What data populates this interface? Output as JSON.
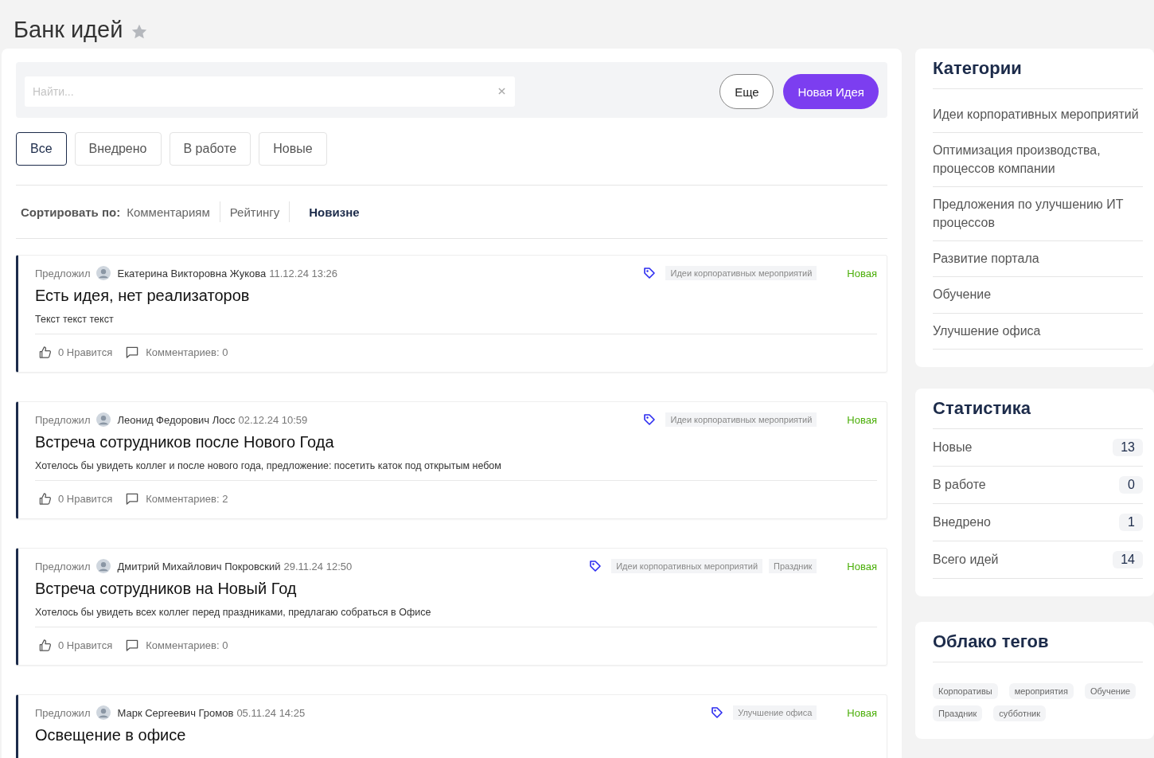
{
  "page": {
    "title": "Банк идей",
    "favorite": false
  },
  "search": {
    "placeholder": "Найти..."
  },
  "buttons": {
    "more": "Еще",
    "new_idea": "Новая Идея"
  },
  "filters": [
    {
      "label": "Все",
      "selected": true
    },
    {
      "label": "Внедрено",
      "selected": false
    },
    {
      "label": "В работе",
      "selected": false
    },
    {
      "label": "Новые",
      "selected": false
    }
  ],
  "sort": {
    "label": "Сортировать по:",
    "options": [
      {
        "label": "Комментариям",
        "selected": false
      },
      {
        "label": "Рейтингу",
        "selected": false
      },
      {
        "label": "Новизне",
        "selected": true
      }
    ]
  },
  "ideas": [
    {
      "prefix": "Предложил",
      "author": "Екатерина Викторовна Жукова",
      "date": "11.12.24 13:26",
      "tags": [
        "Идеи корпоративных мероприятий"
      ],
      "status": "Новая",
      "title": "Есть идея, нет реализаторов",
      "text": "Текст текст текст",
      "likes": "0 Нравится",
      "comments": "Комментариев: 0"
    },
    {
      "prefix": "Предложил",
      "author": "Леонид Федорович Лосс",
      "date": "02.12.24 10:59",
      "tags": [
        "Идеи корпоративных мероприятий"
      ],
      "status": "Новая",
      "title": "Встреча сотрудников после Нового Года",
      "text": "Хотелось бы увидеть коллег и после нового года, предложение: посетить каток под открытым небом",
      "likes": "0 Нравится",
      "comments": "Комментариев: 2"
    },
    {
      "prefix": "Предложил",
      "author": "Дмитрий Михайлович Покровский",
      "date": "29.11.24 12:50",
      "tags": [
        "Идеи корпоративных мероприятий",
        "Праздник"
      ],
      "status": "Новая",
      "title": "Встреча сотрудников на Новый Год",
      "text": "Хотелось бы увидеть всех коллег перед праздниками, предлагаю собраться в Офисе",
      "likes": "0 Нравится",
      "comments": "Комментариев: 0"
    },
    {
      "prefix": "Предложил",
      "author": "Марк Сергеевич Громов",
      "date": "05.11.24 14:25",
      "tags": [
        "Улучшение офиса"
      ],
      "status": "Новая",
      "title": "Освещение в офисе"
    }
  ],
  "categories": {
    "title": "Категории",
    "items": [
      "Идеи корпоративных мероприятий",
      "Оптимизация производства, процессов компании",
      "Предложения по улучшению ИТ процессов",
      "Развитие портала",
      "Обучение",
      "Улучшение офиса"
    ]
  },
  "statistics": {
    "title": "Статистика",
    "items": [
      {
        "label": "Новые",
        "count": "13"
      },
      {
        "label": "В работе",
        "count": "0"
      },
      {
        "label": "Внедрено",
        "count": "1"
      },
      {
        "label": "Всего идей",
        "count": "14"
      }
    ]
  },
  "tag_cloud": {
    "title": "Облако тегов",
    "tags": [
      "Корпоративы",
      "мероприятия",
      "Обучение",
      "Праздник",
      "субботник"
    ]
  }
}
